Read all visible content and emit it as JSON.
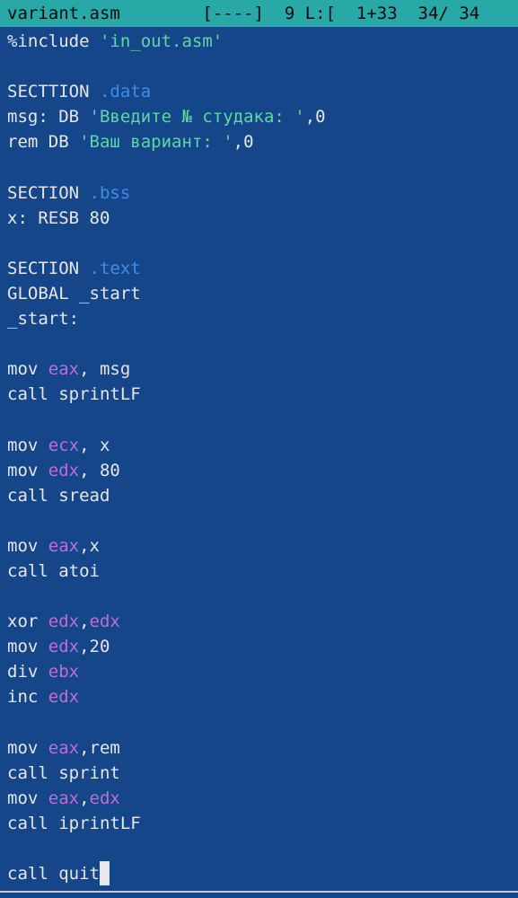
{
  "status_bar": {
    "text": "variant.asm        [----]  9 L:[  1+33  34/ 34"
  },
  "code_lines": [
    [
      {
        "t": "%include ",
        "c": "plain"
      },
      {
        "t": "'in_out.asm'",
        "c": "str"
      }
    ],
    [],
    [
      {
        "t": "SECTTION ",
        "c": "plain"
      },
      {
        "t": ".data",
        "c": "sec"
      }
    ],
    [
      {
        "t": "msg: DB ",
        "c": "plain"
      },
      {
        "t": "'Введите № студака: '",
        "c": "str"
      },
      {
        "t": ",0",
        "c": "plain"
      }
    ],
    [
      {
        "t": "rem DB ",
        "c": "plain"
      },
      {
        "t": "'Ваш вариант: '",
        "c": "str"
      },
      {
        "t": ",0",
        "c": "plain"
      }
    ],
    [],
    [
      {
        "t": "SECTION ",
        "c": "plain"
      },
      {
        "t": ".bss",
        "c": "sec"
      }
    ],
    [
      {
        "t": "x: RESB 80",
        "c": "plain"
      }
    ],
    [],
    [
      {
        "t": "SECTION ",
        "c": "plain"
      },
      {
        "t": ".text",
        "c": "sec"
      }
    ],
    [
      {
        "t": "GLOBAL _start",
        "c": "plain"
      }
    ],
    [
      {
        "t": "_start:",
        "c": "plain"
      }
    ],
    [],
    [
      {
        "t": "mov ",
        "c": "plain"
      },
      {
        "t": "eax",
        "c": "reg"
      },
      {
        "t": ", msg",
        "c": "plain"
      }
    ],
    [
      {
        "t": "call sprintLF",
        "c": "plain"
      }
    ],
    [],
    [
      {
        "t": "mov ",
        "c": "plain"
      },
      {
        "t": "ecx",
        "c": "reg"
      },
      {
        "t": ", x",
        "c": "plain"
      }
    ],
    [
      {
        "t": "mov ",
        "c": "plain"
      },
      {
        "t": "edx",
        "c": "reg"
      },
      {
        "t": ", 80",
        "c": "plain"
      }
    ],
    [
      {
        "t": "call sread",
        "c": "plain"
      }
    ],
    [],
    [
      {
        "t": "mov ",
        "c": "plain"
      },
      {
        "t": "eax",
        "c": "reg"
      },
      {
        "t": ",x",
        "c": "plain"
      }
    ],
    [
      {
        "t": "call atoi",
        "c": "plain"
      }
    ],
    [],
    [
      {
        "t": "xor ",
        "c": "plain"
      },
      {
        "t": "edx",
        "c": "reg"
      },
      {
        "t": ",",
        "c": "plain"
      },
      {
        "t": "edx",
        "c": "reg"
      }
    ],
    [
      {
        "t": "mov ",
        "c": "plain"
      },
      {
        "t": "edx",
        "c": "reg"
      },
      {
        "t": ",20",
        "c": "plain"
      }
    ],
    [
      {
        "t": "div ",
        "c": "plain"
      },
      {
        "t": "ebx",
        "c": "reg"
      }
    ],
    [
      {
        "t": "inc ",
        "c": "plain"
      },
      {
        "t": "edx",
        "c": "reg"
      }
    ],
    [],
    [
      {
        "t": "mov ",
        "c": "plain"
      },
      {
        "t": "eax",
        "c": "reg"
      },
      {
        "t": ",rem",
        "c": "plain"
      }
    ],
    [
      {
        "t": "call sprint",
        "c": "plain"
      }
    ],
    [
      {
        "t": "mov ",
        "c": "plain"
      },
      {
        "t": "eax",
        "c": "reg"
      },
      {
        "t": ",",
        "c": "plain"
      },
      {
        "t": "edx",
        "c": "reg"
      }
    ],
    [
      {
        "t": "call iprintLF",
        "c": "plain"
      }
    ],
    [],
    [
      {
        "t": "call quit",
        "c": "plain"
      }
    ]
  ],
  "cursor_line": 33,
  "colors": {
    "background": "#16468a",
    "status_bar": "#29a8a8",
    "plain_text": "#e6e6e6",
    "string": "#5fd7a5",
    "section_name": "#3d8ee8",
    "register": "#c06bd6"
  }
}
